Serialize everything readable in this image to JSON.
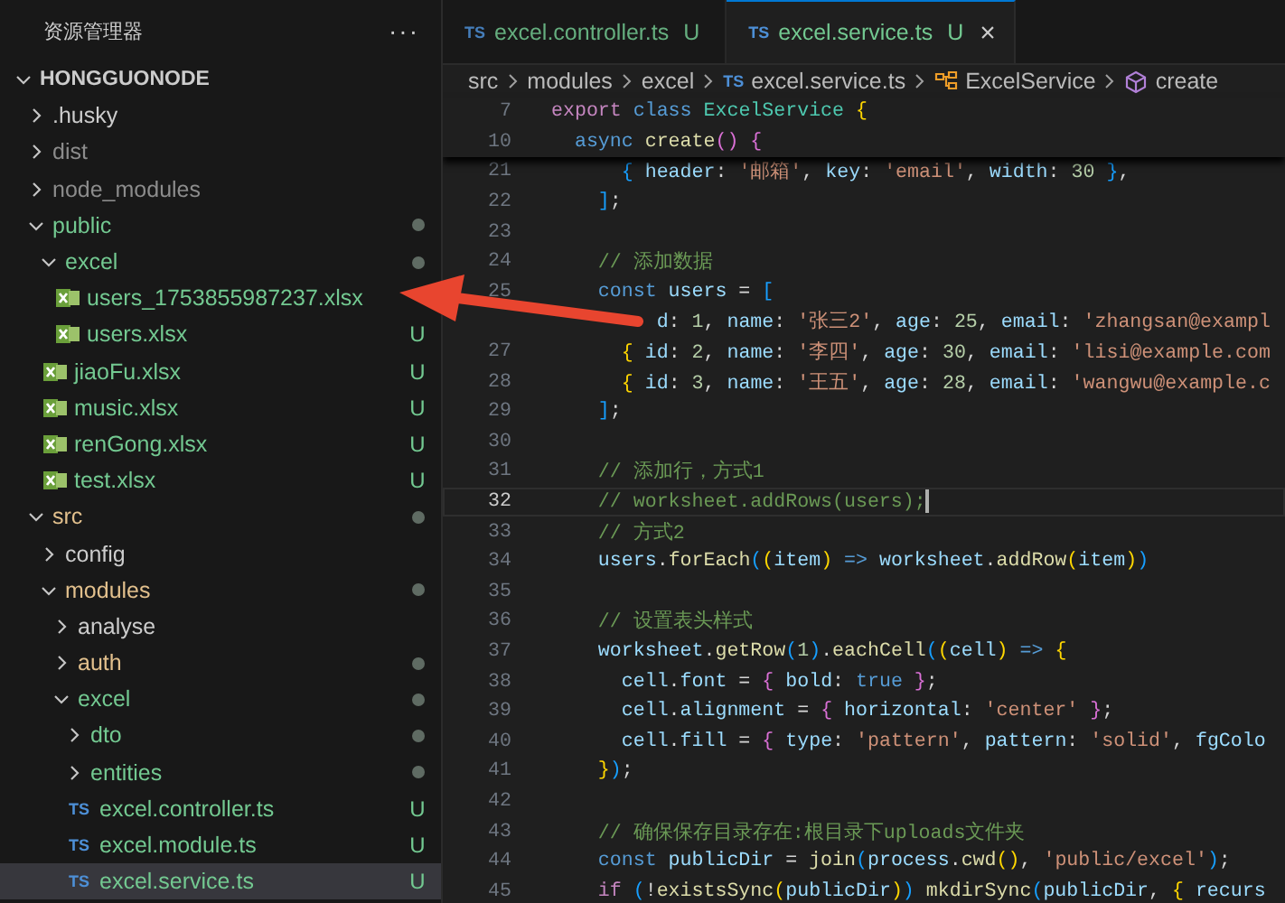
{
  "explorer": {
    "title": "资源管理器",
    "more": "···",
    "root": {
      "label": "HONGGUONODE",
      "expanded": true
    },
    "tree": [
      {
        "label": ".husky",
        "kind": "folder",
        "expanded": false,
        "color": "#cccccc",
        "dot": false,
        "selected": false
      },
      {
        "label": "dist",
        "kind": "folder",
        "expanded": false,
        "color": "#8c8c8c",
        "dot": false,
        "selected": false
      },
      {
        "label": "node_modules",
        "kind": "folder",
        "expanded": false,
        "color": "#8c8c8c",
        "dot": false,
        "selected": false
      },
      {
        "label": "public",
        "kind": "folder",
        "expanded": true,
        "color": "#73c991",
        "dot": true,
        "selected": false,
        "children": [
          {
            "label": "excel",
            "kind": "folder",
            "expanded": true,
            "color": "#73c991",
            "dot": true,
            "selected": false,
            "children": [
              {
                "label": "users_1753855987237.xlsx",
                "kind": "xlsx",
                "color": "#73c991",
                "selected": false
              },
              {
                "label": "users.xlsx",
                "kind": "xlsx",
                "color": "#73c991",
                "badge": "U",
                "selected": false
              }
            ]
          },
          {
            "label": "jiaoFu.xlsx",
            "kind": "xlsx",
            "color": "#73c991",
            "badge": "U",
            "selected": false
          },
          {
            "label": "music.xlsx",
            "kind": "xlsx",
            "color": "#73c991",
            "badge": "U",
            "selected": false
          },
          {
            "label": "renGong.xlsx",
            "kind": "xlsx",
            "color": "#73c991",
            "badge": "U",
            "selected": false
          },
          {
            "label": "test.xlsx",
            "kind": "xlsx",
            "color": "#73c991",
            "badge": "U",
            "selected": false
          }
        ]
      },
      {
        "label": "src",
        "kind": "folder",
        "expanded": true,
        "color": "#e2c08d",
        "dot": true,
        "selected": false,
        "children": [
          {
            "label": "config",
            "kind": "folder",
            "expanded": false,
            "color": "#cccccc",
            "dot": false,
            "selected": false
          },
          {
            "label": "modules",
            "kind": "folder",
            "expanded": true,
            "color": "#e2c08d",
            "dot": true,
            "selected": false,
            "children": [
              {
                "label": "analyse",
                "kind": "folder",
                "expanded": false,
                "color": "#cccccc",
                "dot": false,
                "selected": false
              },
              {
                "label": "auth",
                "kind": "folder",
                "expanded": false,
                "color": "#e2c08d",
                "dot": true,
                "selected": false
              },
              {
                "label": "excel",
                "kind": "folder",
                "expanded": true,
                "color": "#73c991",
                "dot": true,
                "selected": false,
                "children": [
                  {
                    "label": "dto",
                    "kind": "folder",
                    "expanded": false,
                    "color": "#73c991",
                    "dot": true,
                    "selected": false
                  },
                  {
                    "label": "entities",
                    "kind": "folder",
                    "expanded": false,
                    "color": "#73c991",
                    "dot": true,
                    "selected": false
                  },
                  {
                    "label": "excel.controller.ts",
                    "kind": "ts",
                    "icon": "TS",
                    "color": "#73c991",
                    "badge": "U",
                    "selected": false
                  },
                  {
                    "label": "excel.module.ts",
                    "kind": "ts",
                    "icon": "TS",
                    "color": "#73c991",
                    "badge": "U",
                    "selected": false
                  },
                  {
                    "label": "excel.service.ts",
                    "kind": "ts",
                    "icon": "TS",
                    "color": "#73c991",
                    "badge": "U",
                    "selected": true
                  }
                ]
              }
            ]
          }
        ]
      }
    ]
  },
  "tabs": [
    {
      "icon": "TS",
      "label": "excel.controller.ts",
      "badge": "U",
      "selected": false
    },
    {
      "icon": "TS",
      "label": "excel.service.ts",
      "badge": "U",
      "selected": true,
      "close": "×"
    }
  ],
  "breadcrumb": [
    {
      "kind": "folder",
      "label": "src"
    },
    {
      "kind": "folder",
      "label": "modules"
    },
    {
      "kind": "folder",
      "label": "excel"
    },
    {
      "kind": "ts",
      "icon": "TS",
      "label": "excel.service.ts"
    },
    {
      "kind": "class",
      "label": "ExcelService"
    },
    {
      "kind": "method",
      "label": "create"
    }
  ],
  "sticky_lines": [
    {
      "number": "7",
      "tokens": [
        {
          "kind": "kw",
          "text": "export "
        },
        {
          "kind": "st",
          "text": "class "
        },
        {
          "kind": "cls",
          "text": "ExcelService "
        },
        {
          "kind": "b1",
          "text": "{"
        }
      ]
    },
    {
      "number": "10",
      "tokens": [
        {
          "kind": "st",
          "text": "  async "
        },
        {
          "kind": "fn",
          "text": "create"
        },
        {
          "kind": "b2",
          "text": "() {"
        }
      ]
    }
  ],
  "lines": [
    {
      "number": "21",
      "current": false,
      "tokens": [
        {
          "kind": "b3",
          "text": "      { "
        },
        {
          "kind": "var",
          "text": "header"
        },
        {
          "kind": "p",
          "text": ": "
        },
        {
          "kind": "str",
          "text": "'邮箱'"
        },
        {
          "kind": "p",
          "text": ", "
        },
        {
          "kind": "var",
          "text": "key"
        },
        {
          "kind": "p",
          "text": ": "
        },
        {
          "kind": "str",
          "text": "'email'"
        },
        {
          "kind": "p",
          "text": ", "
        },
        {
          "kind": "var",
          "text": "width"
        },
        {
          "kind": "p",
          "text": ": "
        },
        {
          "kind": "num",
          "text": "30"
        },
        {
          "kind": "b3",
          "text": " }"
        },
        {
          "kind": "p",
          "text": ","
        }
      ]
    },
    {
      "number": "22",
      "current": false,
      "tokens": [
        {
          "kind": "b3",
          "text": "    ]"
        },
        {
          "kind": "p",
          "text": ";"
        }
      ]
    },
    {
      "number": "23",
      "current": false
    },
    {
      "number": "24",
      "current": false,
      "tokens": [
        {
          "kind": "cmt",
          "text": "    // 添加数据"
        }
      ]
    },
    {
      "number": "25",
      "current": false,
      "tokens": [
        {
          "kind": "st",
          "text": "    const "
        },
        {
          "kind": "var",
          "text": "users"
        },
        {
          "kind": "p",
          "text": " = "
        },
        {
          "kind": "b3",
          "text": "["
        }
      ]
    },
    {
      "current": false,
      "tokens": [
        {
          "kind": "var",
          "text": "         d"
        },
        {
          "kind": "p",
          "text": ": "
        },
        {
          "kind": "num",
          "text": "1"
        },
        {
          "kind": "p",
          "text": ", "
        },
        {
          "kind": "var",
          "text": "name"
        },
        {
          "kind": "p",
          "text": ": "
        },
        {
          "kind": "str",
          "text": "'张三2'"
        },
        {
          "kind": "p",
          "text": ", "
        },
        {
          "kind": "var",
          "text": "age"
        },
        {
          "kind": "p",
          "text": ": "
        },
        {
          "kind": "num",
          "text": "25"
        },
        {
          "kind": "p",
          "text": ", "
        },
        {
          "kind": "var",
          "text": "email"
        },
        {
          "kind": "p",
          "text": ": "
        },
        {
          "kind": "str",
          "text": "'zhangsan@exampl"
        }
      ]
    },
    {
      "number": "27",
      "current": false,
      "tokens": [
        {
          "kind": "b1",
          "text": "      { "
        },
        {
          "kind": "var",
          "text": "id"
        },
        {
          "kind": "p",
          "text": ": "
        },
        {
          "kind": "num",
          "text": "2"
        },
        {
          "kind": "p",
          "text": ", "
        },
        {
          "kind": "var",
          "text": "name"
        },
        {
          "kind": "p",
          "text": ": "
        },
        {
          "kind": "str",
          "text": "'李四'"
        },
        {
          "kind": "p",
          "text": ", "
        },
        {
          "kind": "var",
          "text": "age"
        },
        {
          "kind": "p",
          "text": ": "
        },
        {
          "kind": "num",
          "text": "30"
        },
        {
          "kind": "p",
          "text": ", "
        },
        {
          "kind": "var",
          "text": "email"
        },
        {
          "kind": "p",
          "text": ": "
        },
        {
          "kind": "str",
          "text": "'lisi@example.com"
        }
      ]
    },
    {
      "number": "28",
      "current": false,
      "tokens": [
        {
          "kind": "b1",
          "text": "      { "
        },
        {
          "kind": "var",
          "text": "id"
        },
        {
          "kind": "p",
          "text": ": "
        },
        {
          "kind": "num",
          "text": "3"
        },
        {
          "kind": "p",
          "text": ", "
        },
        {
          "kind": "var",
          "text": "name"
        },
        {
          "kind": "p",
          "text": ": "
        },
        {
          "kind": "str",
          "text": "'王五'"
        },
        {
          "kind": "p",
          "text": ", "
        },
        {
          "kind": "var",
          "text": "age"
        },
        {
          "kind": "p",
          "text": ": "
        },
        {
          "kind": "num",
          "text": "28"
        },
        {
          "kind": "p",
          "text": ", "
        },
        {
          "kind": "var",
          "text": "email"
        },
        {
          "kind": "p",
          "text": ": "
        },
        {
          "kind": "str",
          "text": "'wangwu@example.c"
        }
      ]
    },
    {
      "number": "29",
      "current": false,
      "tokens": [
        {
          "kind": "b3",
          "text": "    ]"
        },
        {
          "kind": "p",
          "text": ";"
        }
      ]
    },
    {
      "number": "30",
      "current": false
    },
    {
      "number": "31",
      "current": false,
      "tokens": [
        {
          "kind": "cmt",
          "text": "    // 添加行，方式1"
        }
      ]
    },
    {
      "number": "32",
      "current": true,
      "tokens": [
        {
          "kind": "cmt",
          "text": "    // worksheet.addRows(users);"
        }
      ]
    },
    {
      "number": "33",
      "current": false,
      "tokens": [
        {
          "kind": "cmt",
          "text": "    // 方式2"
        }
      ]
    },
    {
      "number": "34",
      "current": false,
      "tokens": [
        {
          "kind": "var",
          "text": "    users"
        },
        {
          "kind": "p",
          "text": "."
        },
        {
          "kind": "fn",
          "text": "forEach"
        },
        {
          "kind": "b3",
          "text": "("
        },
        {
          "kind": "b1",
          "text": "("
        },
        {
          "kind": "var",
          "text": "item"
        },
        {
          "kind": "b1",
          "text": ")"
        },
        {
          "kind": "st",
          "text": " => "
        },
        {
          "kind": "var",
          "text": "worksheet"
        },
        {
          "kind": "p",
          "text": "."
        },
        {
          "kind": "fn",
          "text": "addRow"
        },
        {
          "kind": "b1",
          "text": "("
        },
        {
          "kind": "var",
          "text": "item"
        },
        {
          "kind": "b1",
          "text": ")"
        },
        {
          "kind": "b3",
          "text": ")"
        }
      ]
    },
    {
      "number": "35",
      "current": false
    },
    {
      "number": "36",
      "current": false,
      "tokens": [
        {
          "kind": "cmt",
          "text": "    // 设置表头样式"
        }
      ]
    },
    {
      "number": "37",
      "current": false,
      "tokens": [
        {
          "kind": "var",
          "text": "    worksheet"
        },
        {
          "kind": "p",
          "text": "."
        },
        {
          "kind": "fn",
          "text": "getRow"
        },
        {
          "kind": "b3",
          "text": "("
        },
        {
          "kind": "num",
          "text": "1"
        },
        {
          "kind": "b3",
          "text": ")"
        },
        {
          "kind": "p",
          "text": "."
        },
        {
          "kind": "fn",
          "text": "eachCell"
        },
        {
          "kind": "b3",
          "text": "("
        },
        {
          "kind": "b1",
          "text": "("
        },
        {
          "kind": "var",
          "text": "cell"
        },
        {
          "kind": "b1",
          "text": ")"
        },
        {
          "kind": "st",
          "text": " => "
        },
        {
          "kind": "b1",
          "text": "{"
        }
      ]
    },
    {
      "number": "38",
      "current": false,
      "tokens": [
        {
          "kind": "var",
          "text": "      cell"
        },
        {
          "kind": "p",
          "text": "."
        },
        {
          "kind": "var",
          "text": "font"
        },
        {
          "kind": "p",
          "text": " = "
        },
        {
          "kind": "b2",
          "text": "{ "
        },
        {
          "kind": "var",
          "text": "bold"
        },
        {
          "kind": "p",
          "text": ": "
        },
        {
          "kind": "st",
          "text": "true"
        },
        {
          "kind": "b2",
          "text": " }"
        },
        {
          "kind": "p",
          "text": ";"
        }
      ]
    },
    {
      "number": "39",
      "current": false,
      "tokens": [
        {
          "kind": "var",
          "text": "      cell"
        },
        {
          "kind": "p",
          "text": "."
        },
        {
          "kind": "var",
          "text": "alignment"
        },
        {
          "kind": "p",
          "text": " = "
        },
        {
          "kind": "b2",
          "text": "{ "
        },
        {
          "kind": "var",
          "text": "horizontal"
        },
        {
          "kind": "p",
          "text": ": "
        },
        {
          "kind": "str",
          "text": "'center'"
        },
        {
          "kind": "b2",
          "text": " }"
        },
        {
          "kind": "p",
          "text": ";"
        }
      ]
    },
    {
      "number": "40",
      "current": false,
      "tokens": [
        {
          "kind": "var",
          "text": "      cell"
        },
        {
          "kind": "p",
          "text": "."
        },
        {
          "kind": "var",
          "text": "fill"
        },
        {
          "kind": "p",
          "text": " = "
        },
        {
          "kind": "b2",
          "text": "{ "
        },
        {
          "kind": "var",
          "text": "type"
        },
        {
          "kind": "p",
          "text": ": "
        },
        {
          "kind": "str",
          "text": "'pattern'"
        },
        {
          "kind": "p",
          "text": ", "
        },
        {
          "kind": "var",
          "text": "pattern"
        },
        {
          "kind": "p",
          "text": ": "
        },
        {
          "kind": "str",
          "text": "'solid'"
        },
        {
          "kind": "p",
          "text": ", "
        },
        {
          "kind": "var",
          "text": "fgColo"
        }
      ]
    },
    {
      "number": "41",
      "current": false,
      "tokens": [
        {
          "kind": "b1",
          "text": "    }"
        },
        {
          "kind": "b3",
          "text": ")"
        },
        {
          "kind": "p",
          "text": ";"
        }
      ]
    },
    {
      "number": "42",
      "current": false
    },
    {
      "number": "43",
      "current": false,
      "tokens": [
        {
          "kind": "cmt",
          "text": "    // 确保保存目录存在:根目录下uploads文件夹"
        }
      ]
    },
    {
      "number": "44",
      "current": false,
      "tokens": [
        {
          "kind": "st",
          "text": "    const "
        },
        {
          "kind": "var",
          "text": "publicDir"
        },
        {
          "kind": "p",
          "text": " = "
        },
        {
          "kind": "fn",
          "text": "join"
        },
        {
          "kind": "b3",
          "text": "("
        },
        {
          "kind": "var",
          "text": "process"
        },
        {
          "kind": "p",
          "text": "."
        },
        {
          "kind": "fn",
          "text": "cwd"
        },
        {
          "kind": "b1",
          "text": "()"
        },
        {
          "kind": "p",
          "text": ", "
        },
        {
          "kind": "str",
          "text": "'public/excel'"
        },
        {
          "kind": "b3",
          "text": ")"
        },
        {
          "kind": "p",
          "text": ";"
        }
      ]
    },
    {
      "number": "45",
      "current": false,
      "tokens": [
        {
          "kind": "kw",
          "text": "    if "
        },
        {
          "kind": "b3",
          "text": "("
        },
        {
          "kind": "p",
          "text": "!"
        },
        {
          "kind": "fn",
          "text": "existsSync"
        },
        {
          "kind": "b1",
          "text": "("
        },
        {
          "kind": "var",
          "text": "publicDir"
        },
        {
          "kind": "b1",
          "text": ")"
        },
        {
          "kind": "b3",
          "text": ")"
        },
        {
          "kind": "fn",
          "text": " mkdirSync"
        },
        {
          "kind": "b3",
          "text": "("
        },
        {
          "kind": "var",
          "text": "publicDir"
        },
        {
          "kind": "p",
          "text": ", "
        },
        {
          "kind": "b1",
          "text": "{ "
        },
        {
          "kind": "var",
          "text": "recurs"
        }
      ]
    }
  ]
}
